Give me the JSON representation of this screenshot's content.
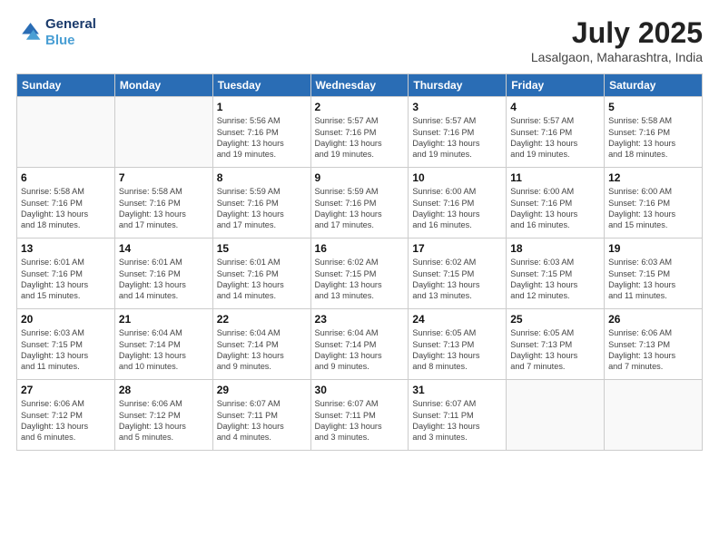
{
  "logo": {
    "line1": "General",
    "line2": "Blue"
  },
  "title": "July 2025",
  "location": "Lasalgaon, Maharashtra, India",
  "weekdays": [
    "Sunday",
    "Monday",
    "Tuesday",
    "Wednesday",
    "Thursday",
    "Friday",
    "Saturday"
  ],
  "weeks": [
    [
      {
        "day": "",
        "info": ""
      },
      {
        "day": "",
        "info": ""
      },
      {
        "day": "1",
        "info": "Sunrise: 5:56 AM\nSunset: 7:16 PM\nDaylight: 13 hours\nand 19 minutes."
      },
      {
        "day": "2",
        "info": "Sunrise: 5:57 AM\nSunset: 7:16 PM\nDaylight: 13 hours\nand 19 minutes."
      },
      {
        "day": "3",
        "info": "Sunrise: 5:57 AM\nSunset: 7:16 PM\nDaylight: 13 hours\nand 19 minutes."
      },
      {
        "day": "4",
        "info": "Sunrise: 5:57 AM\nSunset: 7:16 PM\nDaylight: 13 hours\nand 19 minutes."
      },
      {
        "day": "5",
        "info": "Sunrise: 5:58 AM\nSunset: 7:16 PM\nDaylight: 13 hours\nand 18 minutes."
      }
    ],
    [
      {
        "day": "6",
        "info": "Sunrise: 5:58 AM\nSunset: 7:16 PM\nDaylight: 13 hours\nand 18 minutes."
      },
      {
        "day": "7",
        "info": "Sunrise: 5:58 AM\nSunset: 7:16 PM\nDaylight: 13 hours\nand 17 minutes."
      },
      {
        "day": "8",
        "info": "Sunrise: 5:59 AM\nSunset: 7:16 PM\nDaylight: 13 hours\nand 17 minutes."
      },
      {
        "day": "9",
        "info": "Sunrise: 5:59 AM\nSunset: 7:16 PM\nDaylight: 13 hours\nand 17 minutes."
      },
      {
        "day": "10",
        "info": "Sunrise: 6:00 AM\nSunset: 7:16 PM\nDaylight: 13 hours\nand 16 minutes."
      },
      {
        "day": "11",
        "info": "Sunrise: 6:00 AM\nSunset: 7:16 PM\nDaylight: 13 hours\nand 16 minutes."
      },
      {
        "day": "12",
        "info": "Sunrise: 6:00 AM\nSunset: 7:16 PM\nDaylight: 13 hours\nand 15 minutes."
      }
    ],
    [
      {
        "day": "13",
        "info": "Sunrise: 6:01 AM\nSunset: 7:16 PM\nDaylight: 13 hours\nand 15 minutes."
      },
      {
        "day": "14",
        "info": "Sunrise: 6:01 AM\nSunset: 7:16 PM\nDaylight: 13 hours\nand 14 minutes."
      },
      {
        "day": "15",
        "info": "Sunrise: 6:01 AM\nSunset: 7:16 PM\nDaylight: 13 hours\nand 14 minutes."
      },
      {
        "day": "16",
        "info": "Sunrise: 6:02 AM\nSunset: 7:15 PM\nDaylight: 13 hours\nand 13 minutes."
      },
      {
        "day": "17",
        "info": "Sunrise: 6:02 AM\nSunset: 7:15 PM\nDaylight: 13 hours\nand 13 minutes."
      },
      {
        "day": "18",
        "info": "Sunrise: 6:03 AM\nSunset: 7:15 PM\nDaylight: 13 hours\nand 12 minutes."
      },
      {
        "day": "19",
        "info": "Sunrise: 6:03 AM\nSunset: 7:15 PM\nDaylight: 13 hours\nand 11 minutes."
      }
    ],
    [
      {
        "day": "20",
        "info": "Sunrise: 6:03 AM\nSunset: 7:15 PM\nDaylight: 13 hours\nand 11 minutes."
      },
      {
        "day": "21",
        "info": "Sunrise: 6:04 AM\nSunset: 7:14 PM\nDaylight: 13 hours\nand 10 minutes."
      },
      {
        "day": "22",
        "info": "Sunrise: 6:04 AM\nSunset: 7:14 PM\nDaylight: 13 hours\nand 9 minutes."
      },
      {
        "day": "23",
        "info": "Sunrise: 6:04 AM\nSunset: 7:14 PM\nDaylight: 13 hours\nand 9 minutes."
      },
      {
        "day": "24",
        "info": "Sunrise: 6:05 AM\nSunset: 7:13 PM\nDaylight: 13 hours\nand 8 minutes."
      },
      {
        "day": "25",
        "info": "Sunrise: 6:05 AM\nSunset: 7:13 PM\nDaylight: 13 hours\nand 7 minutes."
      },
      {
        "day": "26",
        "info": "Sunrise: 6:06 AM\nSunset: 7:13 PM\nDaylight: 13 hours\nand 7 minutes."
      }
    ],
    [
      {
        "day": "27",
        "info": "Sunrise: 6:06 AM\nSunset: 7:12 PM\nDaylight: 13 hours\nand 6 minutes."
      },
      {
        "day": "28",
        "info": "Sunrise: 6:06 AM\nSunset: 7:12 PM\nDaylight: 13 hours\nand 5 minutes."
      },
      {
        "day": "29",
        "info": "Sunrise: 6:07 AM\nSunset: 7:11 PM\nDaylight: 13 hours\nand 4 minutes."
      },
      {
        "day": "30",
        "info": "Sunrise: 6:07 AM\nSunset: 7:11 PM\nDaylight: 13 hours\nand 3 minutes."
      },
      {
        "day": "31",
        "info": "Sunrise: 6:07 AM\nSunset: 7:11 PM\nDaylight: 13 hours\nand 3 minutes."
      },
      {
        "day": "",
        "info": ""
      },
      {
        "day": "",
        "info": ""
      }
    ]
  ]
}
